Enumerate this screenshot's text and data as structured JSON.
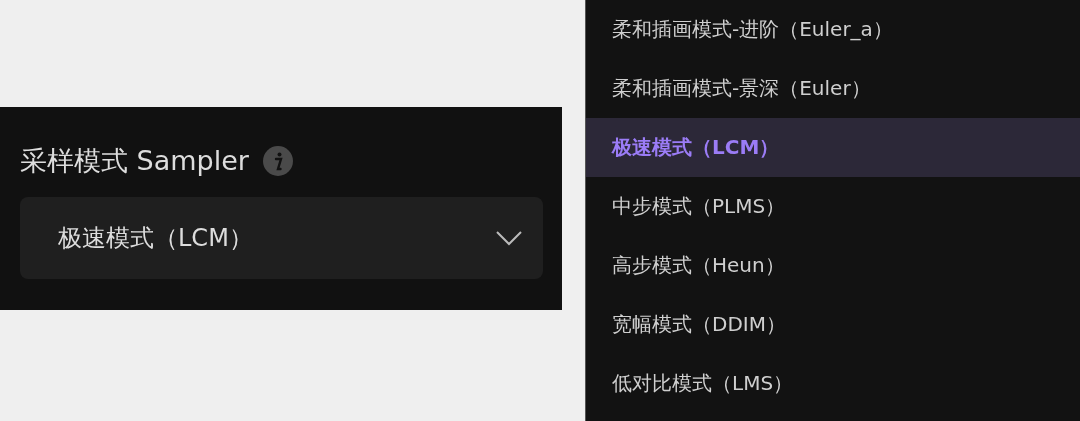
{
  "sampler": {
    "label": "采样模式 Sampler",
    "value": "极速模式（LCM）"
  },
  "menu": [
    {
      "label": "柔和插画模式-进阶（Euler_a）",
      "selected": false
    },
    {
      "label": "柔和插画模式-景深（Euler）",
      "selected": false
    },
    {
      "label": "极速模式（LCM）",
      "selected": true
    },
    {
      "label": "中步模式（PLMS）",
      "selected": false
    },
    {
      "label": "高步模式（Heun）",
      "selected": false
    },
    {
      "label": "宽幅模式（DDIM）",
      "selected": false
    },
    {
      "label": "低对比模式（LMS）",
      "selected": false
    }
  ]
}
